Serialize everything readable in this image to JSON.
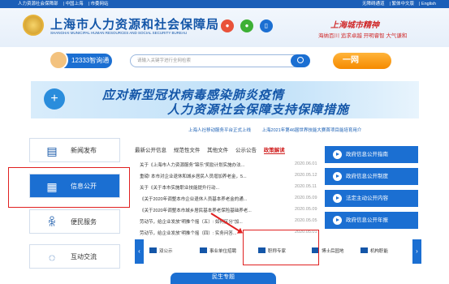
{
  "topbar": {
    "left": [
      "人力资源社会保障部",
      "中国上海",
      "市委网站"
    ],
    "right": [
      "无障碍通道",
      "繁体中文版",
      "English"
    ]
  },
  "header": {
    "title": "上海市人力资源和社会保障局",
    "subtitle": "SHANGHAI MUNICIPAL HUMAN RESOURCES AND SOCIAL SECURITY BUREAU",
    "slogan_title": "上海城市精神",
    "slogan_text": "海纳百川  追求卓越  开明睿智  大气谦和"
  },
  "search": {
    "hotline": "12333智询通",
    "placeholder": "请输入关键字进行全网检索",
    "yiwang": "一网"
  },
  "banner": {
    "line1": "应对新型冠状病毒感染肺炎疫情",
    "line2": "人力资源社会保障支持保障措施"
  },
  "ticker": [
    "上海人社移动服务平台正式上线",
    "上海2021年第46届世界技能大赛首项目能培育用介"
  ],
  "sidenav": [
    {
      "label": "新闻发布",
      "icon": "newspaper-icon"
    },
    {
      "label": "信息公开",
      "icon": "document-icon"
    },
    {
      "label": "便民服务",
      "icon": "user-icon"
    },
    {
      "label": "互动交流",
      "icon": "chat-icon"
    }
  ],
  "tabs": [
    "最新公开信息",
    "规范性文件",
    "其他文件",
    "公示公告",
    "政策解读"
  ],
  "news": [
    {
      "title": "关于《上海市人力资源服务“锦乐”奖励计划实施办法...",
      "date": "2020.06.01"
    },
    {
      "title": "重磅! 本市对企业退休和城乡居民人员增加养老金，5...",
      "date": "2020.05.12"
    },
    {
      "title": "关于《关于本市实施职业技能提升行动...",
      "date": "2020.05.11"
    },
    {
      "title": "《关于2020年调整本市企业退休人员基本养老金的通...",
      "date": "2020.05.09"
    },
    {
      "title": "《关于2020年调整本市城乡居民基本养老保险基础养老...",
      "date": "2020.05.09"
    },
    {
      "title": "劳动节，给企业发放“明推个摇（五）: 如何区分“加...",
      "date": "2020.05.05"
    },
    {
      "title": "劳动节，给企业发放“明推个摇（四）: 实务问答...",
      "date": "2020.05.01"
    }
  ],
  "right_buttons": [
    "政府信息公开指南",
    "政府信息公开制度",
    "法定主动公开内容",
    "政府信息公开年报"
  ],
  "carousel": [
    "双公示",
    "事业单位招聘",
    "职称专家",
    "博士后园地",
    "机构职能"
  ],
  "bottom_title": "民生专题"
}
